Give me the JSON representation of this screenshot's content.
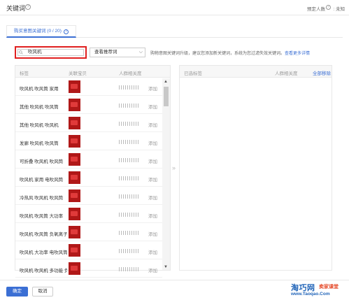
{
  "header": {
    "title": "关键词",
    "help_icon": "?",
    "estimate_label": "预定人数",
    "estimate_value": ": 未知"
  },
  "tabs": [
    {
      "label": "购买意图关键词 (0 / 20)",
      "active": true
    }
  ],
  "search": {
    "value": "吹风机",
    "placeholder": ""
  },
  "select": {
    "value": "查看推荐词"
  },
  "hint": {
    "text": "购物意图关键词升级，建议您添加新关键词，系统为您过滤失效关键词。",
    "more_link": "查看更多详情"
  },
  "left_panel": {
    "columns": {
      "tag": "标签",
      "related": "关联宝贝",
      "relevance": "人群相关度"
    },
    "rows": [
      {
        "keyword": "吹风机 吹风筒 家用",
        "action": "添加"
      },
      {
        "keyword": "其他 吹风机 吹风筒",
        "action": "添加"
      },
      {
        "keyword": "其他 吹风机 吹风机",
        "action": "添加"
      },
      {
        "keyword": "发廊 吹风机 吹风筒",
        "action": "添加"
      },
      {
        "keyword": "可折叠 吹风机 吹风筒",
        "action": "添加"
      },
      {
        "keyword": "吹风机 家用 电吹风筒",
        "action": "添加"
      },
      {
        "keyword": "冷热风 吹风机 吹风筒",
        "action": "添加"
      },
      {
        "keyword": "吹风机 吹风筒 大功率",
        "action": "添加"
      },
      {
        "keyword": "吹风机 吹风筒 负氧离子",
        "action": "添加"
      },
      {
        "keyword": "吹风机 大功率 电吹风筒",
        "action": "添加"
      },
      {
        "keyword": "吹风机 吹风机 多功能 负离子",
        "action": "添加"
      }
    ]
  },
  "right_panel": {
    "columns": {
      "selected": "已选标签",
      "relevance": "人群相关度",
      "clear": "全部移除"
    }
  },
  "footer": {
    "ok": "确定",
    "cancel": "取消"
  },
  "watermark": {
    "brand": "淘巧网",
    "sub": "卖家课堂",
    "url": "www.Taoqao.Com"
  },
  "colors": {
    "accent": "#3b6fd4",
    "highlight": "#e02020",
    "thumb": "#b01818"
  }
}
